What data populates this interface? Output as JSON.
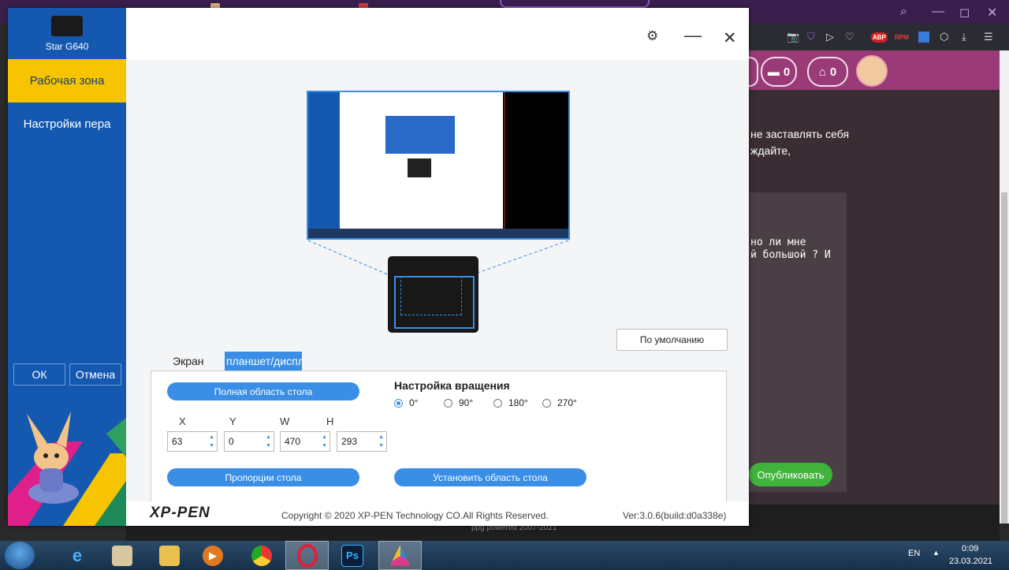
{
  "background": {
    "window_controls": [
      "—",
      "◻",
      "✕"
    ],
    "toolbar_badges": [
      "ABP",
      "RPM"
    ],
    "counters": [
      {
        "icon": "chat-icon",
        "value": "0"
      },
      {
        "icon": "messages-icon",
        "value": "0"
      }
    ],
    "text_line1": "не заставлять себя",
    "text_line2": "ждайте,",
    "mono_line1": "но ли мне",
    "mono_line2": "й большой ? И",
    "publish_label": "Опубликовать",
    "footer_text": "ppg powered 2007-2021"
  },
  "taskbar": {
    "items": [
      "ie-icon",
      "paint-icon",
      "explorer-icon",
      "media-player-icon",
      "chrome-icon",
      "opera-icon",
      "photoshop-icon",
      "xp-pen-icon"
    ],
    "photoshop_label": "Ps",
    "language": "EN",
    "time": "0:09",
    "date": "23.03.2021"
  },
  "app": {
    "device_name": "Star G640",
    "nav": {
      "work_area": "Рабочая зона",
      "pen_settings": "Настройки пера"
    },
    "ok_label": "ОК",
    "cancel_label": "Отмена",
    "default_button": "По умолчанию",
    "tabs": {
      "screen": "Экран",
      "tablet": "планшет/дисплей"
    },
    "full_area_button": "Полная область стола",
    "proportions_button": "Пропорции стола",
    "set_area_button": "Установить область стола",
    "rotation": {
      "title": "Настройка вращения",
      "options": [
        "0°",
        "90°",
        "180°",
        "270°"
      ],
      "selected": "0°"
    },
    "coords": {
      "labels": {
        "x": "X",
        "y": "Y",
        "w": "W",
        "h": "H"
      },
      "values": {
        "x": "63",
        "y": "0",
        "w": "470",
        "h": "293"
      }
    },
    "footer": {
      "logo": "XP-PEN",
      "copyright": "Copyright © 2020 XP-PEN Technology CO.All Rights Reserved.",
      "version": "Ver:3.0.6(build:d0a338e)"
    }
  },
  "colors": {
    "sidebar_blue": "#1458b0",
    "active_yellow": "#f6c400",
    "accent_blue": "#3a8ee6",
    "publish_green": "#3fb33a",
    "site_magenta": "#9a3a76"
  }
}
